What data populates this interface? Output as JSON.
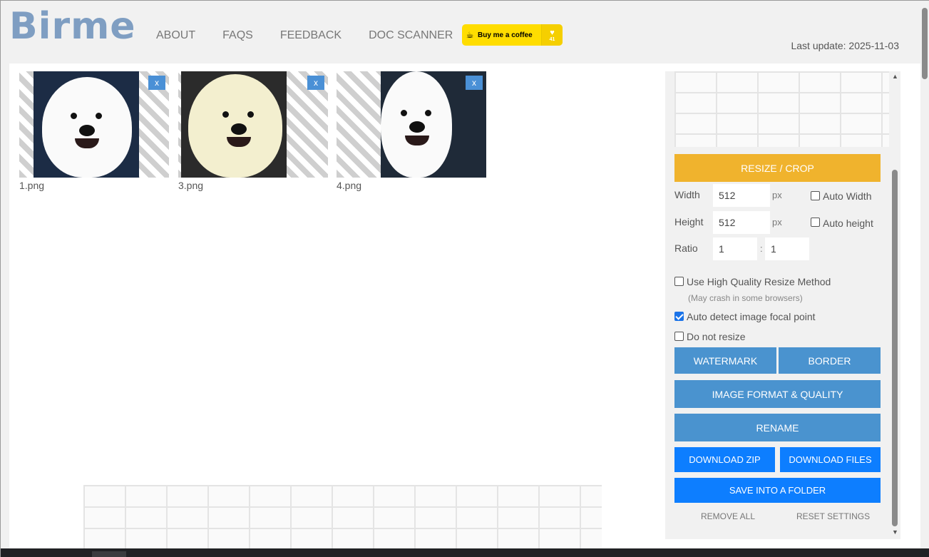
{
  "header": {
    "logo": "Birme",
    "nav": [
      "ABOUT",
      "FAQS",
      "FEEDBACK",
      "DOC SCANNER"
    ],
    "coffee_label": "Buy me a coffee",
    "coffee_count": "41",
    "last_update": "Last update: 2025-11-03"
  },
  "images": [
    {
      "name": "1.png",
      "remove": "x"
    },
    {
      "name": "3.png",
      "remove": "x"
    },
    {
      "name": "4.png",
      "remove": "x"
    }
  ],
  "panel": {
    "resize_crop": "RESIZE / CROP",
    "width_label": "Width",
    "width_value": "512",
    "height_label": "Height",
    "height_value": "512",
    "unit": "px",
    "auto_width": "Auto Width",
    "auto_height": "Auto height",
    "ratio_label": "Ratio",
    "ratio_w": "1",
    "ratio_sep": ":",
    "ratio_h": "1",
    "hq_resize": "Use High Quality Resize Method",
    "hq_note": "(May crash in some browsers)",
    "focal_point": "Auto detect image focal point",
    "focal_checked": true,
    "do_not_resize": "Do not resize",
    "watermark": "WATERMARK",
    "border": "BORDER",
    "format_quality": "IMAGE FORMAT & QUALITY",
    "rename": "RENAME",
    "download_zip": "DOWNLOAD ZIP",
    "download_files": "DOWNLOAD FILES",
    "save_folder": "SAVE INTO A FOLDER",
    "remove_all": "REMOVE ALL",
    "reset_settings": "RESET SETTINGS"
  },
  "colors": {
    "accent_orange": "#f0b32d",
    "steel_blue": "#4a93cf",
    "bright_blue": "#0d7eff",
    "logo": "#7f9ec2"
  }
}
